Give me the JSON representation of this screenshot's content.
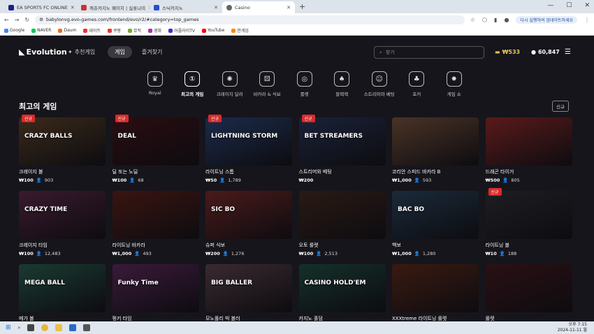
{
  "browser": {
    "tabs": [
      {
        "title": "EA SPORTS FC ONLINE",
        "active": false
      },
      {
        "title": "캐쥬카지노 페이지 | 실롯나미",
        "active": false
      },
      {
        "title": "스닉카지노",
        "active": false
      },
      {
        "title": "Casino",
        "active": true
      }
    ],
    "url": "babylonvg.evo-games.com/frontend/evo/r2/#category=top_games",
    "update_label": "다시 실행하여 업데이트하세요",
    "bookmarks": [
      "Google",
      "NAVER",
      "Daum",
      "네이트",
      "쿠팡",
      "뮤직",
      "영화",
      "어플라이TV",
      "YouTube",
      "한게임"
    ]
  },
  "app": {
    "logo": "Evolution",
    "nav": [
      {
        "label": "추천게임",
        "active": false
      },
      {
        "label": "게임",
        "active": true
      },
      {
        "label": "즐겨찾기",
        "active": false
      }
    ],
    "search_placeholder": "찾기",
    "balance": "₩533",
    "players": "60,847",
    "categories": [
      {
        "label": "Royal",
        "icon": "crown-icon",
        "active": false
      },
      {
        "label": "최고의 게임",
        "icon": "podium-icon",
        "active": true
      },
      {
        "label": "크레이지 달러",
        "icon": "wheel-icon",
        "active": false
      },
      {
        "label": "바카라 & 식보",
        "icon": "dice-icon",
        "active": false
      },
      {
        "label": "룰렛",
        "icon": "roulette-icon",
        "active": false
      },
      {
        "label": "블랙잭",
        "icon": "cards-icon",
        "active": false
      },
      {
        "label": "스트리머와 베팅",
        "icon": "streamer-icon",
        "active": false
      },
      {
        "label": "포커",
        "icon": "poker-icon",
        "active": false
      },
      {
        "label": "게임 쇼",
        "icon": "gameshow-icon",
        "active": false
      }
    ],
    "section_title": "최고의 게임",
    "new_button": "신규",
    "new_badge": "신규",
    "games": [
      {
        "title": "크레이지 볼",
        "bet": "₩100",
        "players": "903",
        "new": true,
        "bg": "#3a2a1a",
        "art": "CRAZY BALLS"
      },
      {
        "title": "딜 또는 노딜",
        "bet": "₩100",
        "players": "68",
        "new": true,
        "bg": "#2a0d10",
        "art": "DEAL"
      },
      {
        "title": "라이트닝 스톰",
        "bet": "₩50",
        "players": "1,789",
        "new": true,
        "bg": "#1b2b4a",
        "art": "LIGHTNING STORM"
      },
      {
        "title": "스트리머와 베팅",
        "bet": "₩200",
        "players": "",
        "new": true,
        "bg": "#1a2238",
        "art": "BET STREAMERS"
      },
      {
        "title": "코리안 스피드 바카라 B",
        "bet": "₩1,000",
        "players": "593",
        "new": false,
        "bg": "#4a3326",
        "art": ""
      },
      {
        "title": "드래곤 타이거",
        "bet": "₩500",
        "players": "805",
        "new": false,
        "bg": "#5a1a1a",
        "art": ""
      },
      {
        "title": "크레이지 타임",
        "bet": "₩100",
        "players": "12,483",
        "new": false,
        "bg": "#3a1a2e",
        "art": "CRAZY TIME"
      },
      {
        "title": "라이트닝 바카라",
        "bet": "₩1,000",
        "players": "493",
        "new": false,
        "bg": "#3a1410",
        "art": ""
      },
      {
        "title": "슈퍼 식보",
        "bet": "₩200",
        "players": "1,276",
        "new": false,
        "bg": "#4a1a1a",
        "art": "SIC BO"
      },
      {
        "title": "오토 룰렛",
        "bet": "₩100",
        "players": "2,513",
        "new": false,
        "bg": "#2a1a14",
        "art": ""
      },
      {
        "title": "백보",
        "bet": "₩1,000",
        "players": "1,280",
        "new": false,
        "bg": "#1a2a3a",
        "art": "BAC BO"
      },
      {
        "title": "라이트닝 볼",
        "bet": "₩10",
        "players": "188",
        "new": true,
        "bg": "#1e1e22",
        "art": ""
      },
      {
        "title": "메가 볼",
        "bet": "",
        "players": "",
        "new": false,
        "bg": "#1a3a32",
        "art": "MEGA BALL"
      },
      {
        "title": "펑키 타임",
        "bet": "",
        "players": "",
        "new": false,
        "bg": "#3a1a3a",
        "art": "Funky Time"
      },
      {
        "title": "모노폴리 빅 볼러",
        "bet": "",
        "players": "",
        "new": false,
        "bg": "#3a2a30",
        "art": "BIG BALLER"
      },
      {
        "title": "카지노 홀덤",
        "bet": "",
        "players": "",
        "new": false,
        "bg": "#14302a",
        "art": "CASINO HOLD'EM"
      },
      {
        "title": "XXXtreme 라이트닝 룰렛",
        "bet": "",
        "players": "",
        "new": false,
        "bg": "#3a1a10",
        "art": ""
      },
      {
        "title": "룰렛",
        "bet": "",
        "players": "",
        "new": false,
        "bg": "#2a1014",
        "art": ""
      }
    ]
  },
  "taskbar": {
    "time": "오후 7:15",
    "date": "2024-11-11 월"
  }
}
